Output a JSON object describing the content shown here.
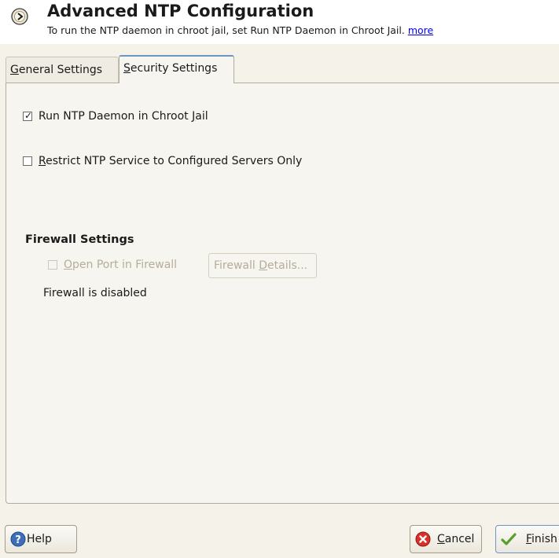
{
  "header": {
    "title": "Advanced NTP Configuration",
    "subtitle": "To run the NTP daemon in chroot jail, set Run NTP Daemon in Chroot Jail.",
    "more_link": "more"
  },
  "tabs": {
    "general": {
      "label": "General Settings",
      "mnemonic": "G",
      "rest": "eneral Settings",
      "active": false
    },
    "security": {
      "label": "Security Settings",
      "mnemonic": "S",
      "rest": "ecurity Settings",
      "active": true
    }
  },
  "security": {
    "chroot": {
      "label": "Run NTP Daemon in Chroot Jail",
      "pre": "Run NTP Daemon in Chroot ",
      "mnemonic": "J",
      "post": "ail",
      "checked": true
    },
    "restrict": {
      "label": "Restrict NTP Service to Configured Servers Only",
      "mnemonic": "R",
      "post": "estrict NTP Service to Configured Servers Only",
      "checked": false
    },
    "firewall": {
      "section_title": "Firewall Settings",
      "open_port": {
        "label": "Open Port in Firewall",
        "mnemonic": "O",
        "post": "pen Port in Firewall",
        "checked": false,
        "enabled": false
      },
      "details_button": {
        "label": "Firewall Details...",
        "pre": "Firewall ",
        "mnemonic": "D",
        "post": "etails...",
        "enabled": false
      },
      "status": "Firewall is disabled"
    }
  },
  "buttons": {
    "help": {
      "label": "Help"
    },
    "cancel": {
      "label": "Cancel",
      "mnemonic": "C",
      "post": "ancel"
    },
    "finish": {
      "label": "Finish",
      "mnemonic": "F",
      "post": "inish"
    }
  },
  "icons": {
    "header": "advanced-config-icon",
    "help": "help-icon",
    "cancel": "cancel-icon",
    "finish": "checkmark-icon"
  },
  "colors": {
    "link": "#0000ee",
    "active_tab_accent": "#6e94c2",
    "disabled_text": "#b5ad9b",
    "background": "#f5f2ea"
  }
}
